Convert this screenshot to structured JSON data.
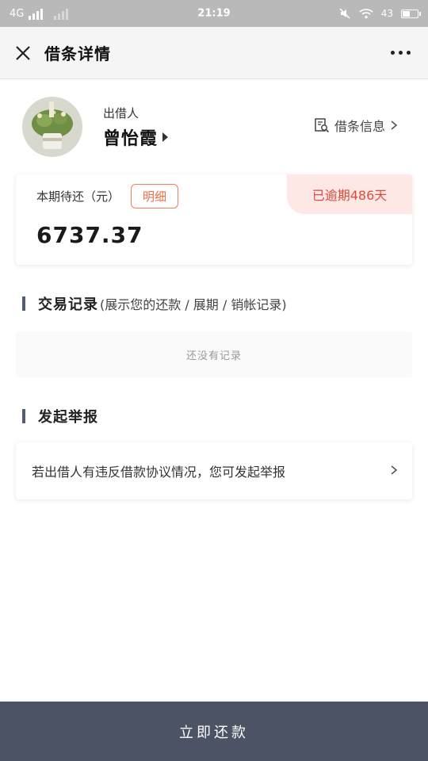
{
  "status_bar": {
    "network": "4G",
    "time": "21:19",
    "battery": "43"
  },
  "nav": {
    "title": "借条详情"
  },
  "lender": {
    "role_label": "出借人",
    "name": "曾怡霞",
    "info_link": "借条信息"
  },
  "due": {
    "label": "本期待还（元）",
    "detail_button": "明细",
    "amount": "6737.37",
    "overdue_badge": "已逾期486天"
  },
  "transactions": {
    "title": "交易记录",
    "subtitle": "(展示您的还款 / 展期 / 销帐记录)",
    "empty_text": "还没有记录"
  },
  "report": {
    "title": "发起举报",
    "text": "若出借人有违反借款协议情况，您可发起举报"
  },
  "footer": {
    "repay_button": "立即还款"
  },
  "colors": {
    "accent": "#ec6a4a",
    "overdue_bg": "#fde8e6",
    "footer_bg": "#4c5364"
  }
}
